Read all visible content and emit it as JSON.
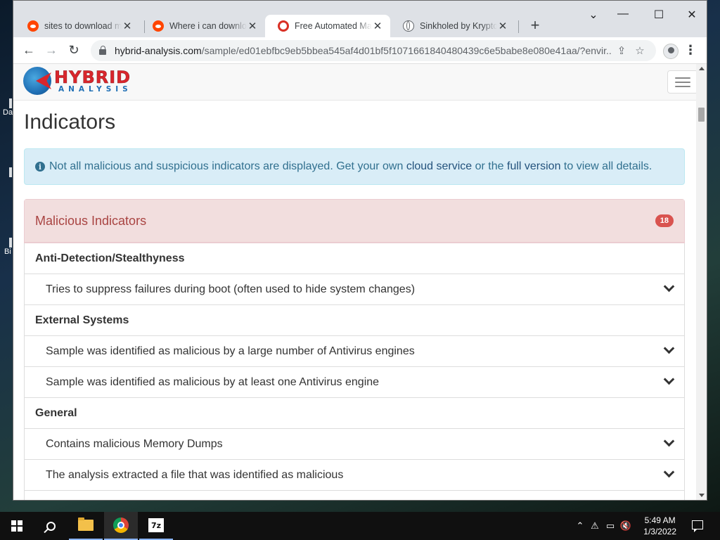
{
  "browser": {
    "tabs": [
      {
        "title": "sites to download ma",
        "icon": "reddit-icon",
        "active": false
      },
      {
        "title": "Where i can downloa",
        "icon": "reddit-icon",
        "active": false
      },
      {
        "title": "Free Automated Malw",
        "icon": "hybrid-analysis-favicon",
        "active": true
      },
      {
        "title": "Sinkholed by Kryptos",
        "icon": "globe-icon",
        "active": false
      }
    ],
    "url_host": "hybrid-analysis.com",
    "url_path": "/sample/ed01ebfbc9eb5bbea545af4d01bf5f1071661840480439c6e5babe8e080e41aa/?envir..."
  },
  "site": {
    "logo_primary": "HYBRID",
    "logo_secondary": "ANALYSIS"
  },
  "page": {
    "title": "Indicators",
    "alert": {
      "text_before": "Not all malicious and suspicious indicators are displayed. Get your own ",
      "link1": "cloud service",
      "text_middle": " or the ",
      "link2": "full version",
      "text_after": " to view all details."
    },
    "panel": {
      "title": "Malicious Indicators",
      "count": "18",
      "groups": [
        {
          "category": "Anti-Detection/Stealthyness",
          "items": [
            "Tries to suppress failures during boot (often used to hide system changes)"
          ]
        },
        {
          "category": "External Systems",
          "items": [
            "Sample was identified as malicious by a large number of Antivirus engines",
            "Sample was identified as malicious by at least one Antivirus engine"
          ]
        },
        {
          "category": "General",
          "items": [
            "Contains malicious Memory Dumps",
            "The analysis extracted a file that was identified as malicious"
          ]
        }
      ]
    }
  },
  "taskbar": {
    "time": "5:49 AM",
    "date": "1/3/2022",
    "apps": [
      "file-explorer-icon",
      "chrome-icon",
      "7zip-icon"
    ],
    "zip_label": "7z"
  },
  "colors": {
    "danger_heading_bg": "#f2dede",
    "danger_text": "#a94442",
    "badge": "#d9534f",
    "info_bg": "#d9edf7",
    "info_text": "#31708f"
  }
}
